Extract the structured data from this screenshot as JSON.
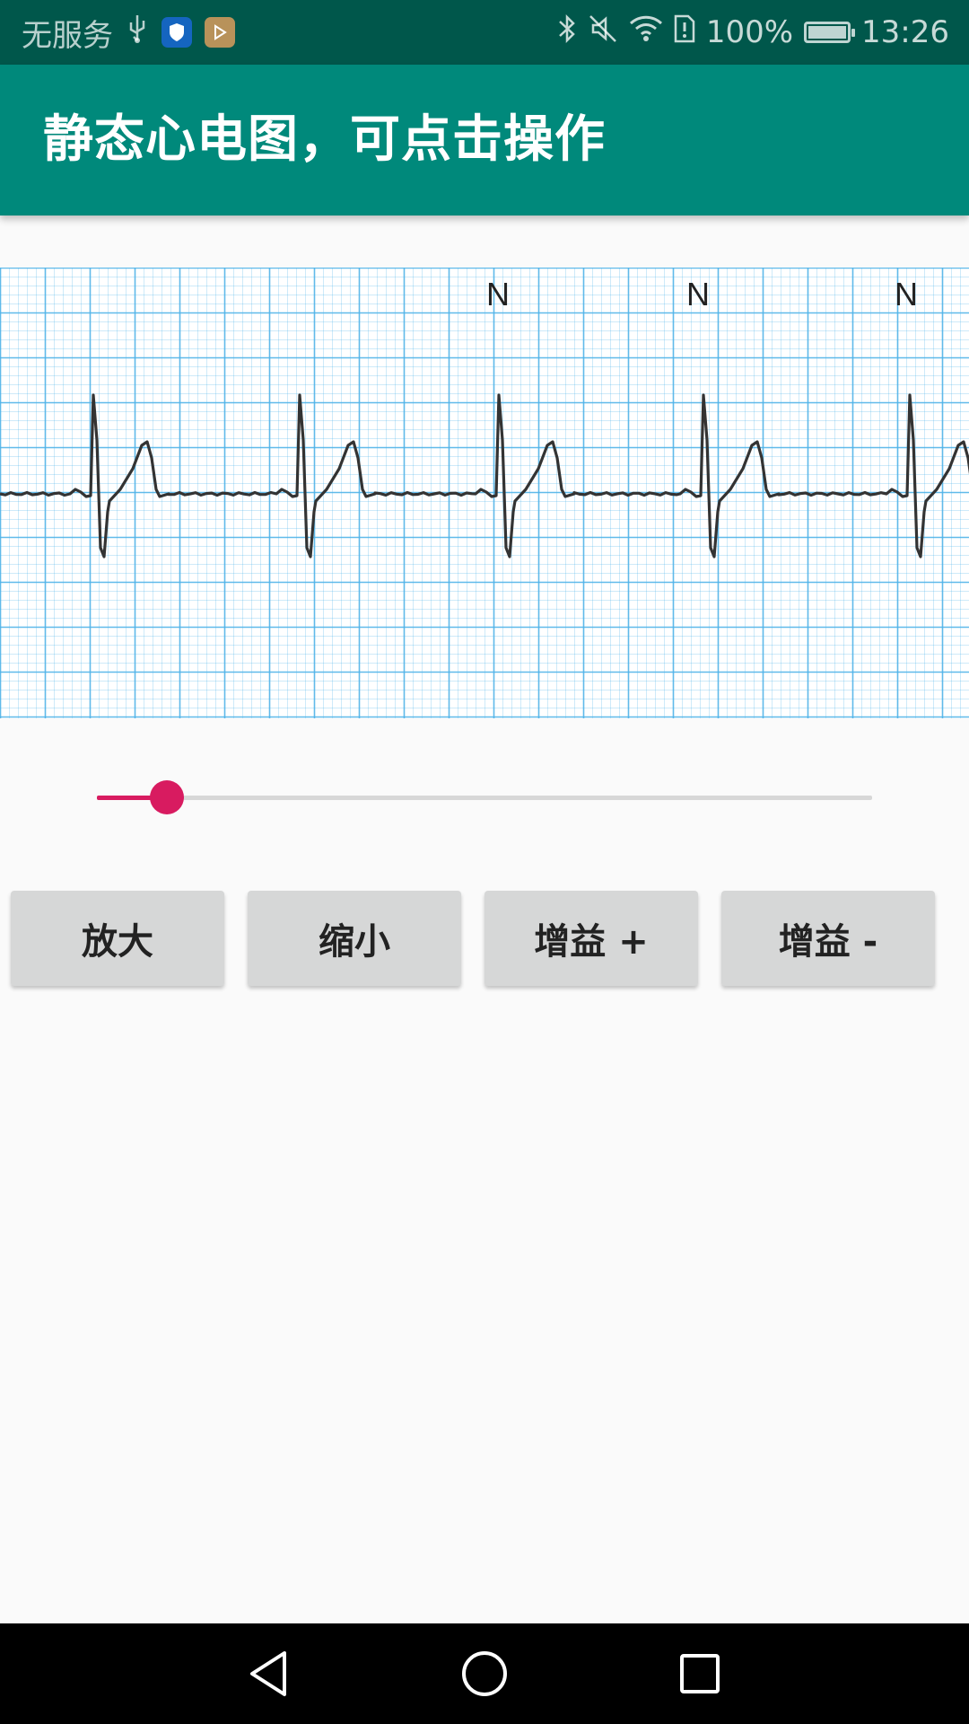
{
  "status_bar": {
    "carrier": "无服务",
    "battery": "100%",
    "time": "13:26",
    "battery_level": 1.0,
    "icons": [
      "usb-icon",
      "shield-app-icon",
      "play-app-icon",
      "bluetooth-icon",
      "mute-icon",
      "wifi-icon",
      "sim-alert-icon",
      "battery-icon"
    ]
  },
  "app_bar": {
    "title": "静态心电图，可点击操作"
  },
  "ecg": {
    "beat_labels": [
      "N",
      "N",
      "N"
    ],
    "grid_color": "#4fb3e8",
    "trace_color": "#333333"
  },
  "slider": {
    "value": 0.09,
    "accent_color": "#d81b60"
  },
  "buttons": {
    "zoom_in": "放大",
    "zoom_out": "缩小",
    "gain_up": "增益 +",
    "gain_down": "增益 -"
  },
  "nav_bar": {
    "icons": [
      "back-icon",
      "home-icon",
      "recents-icon"
    ]
  },
  "colors": {
    "status_bar": "#00574b",
    "app_bar": "#00897b",
    "accent": "#d81b60",
    "button": "#d6d7d7",
    "background": "#fafafa"
  }
}
